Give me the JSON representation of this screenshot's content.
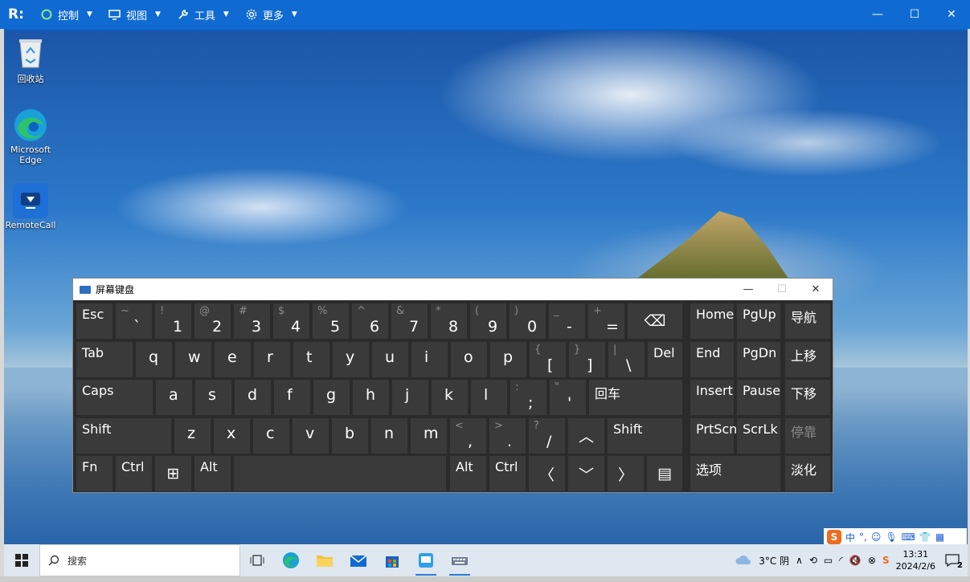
{
  "remote_bar": {
    "logo": "R:",
    "menus": [
      {
        "label": "控制",
        "icon": "power-icon"
      },
      {
        "label": "视图",
        "icon": "monitor-icon"
      },
      {
        "label": "工具",
        "icon": "wrench-icon"
      },
      {
        "label": "更多",
        "icon": "gear-icon"
      }
    ],
    "window_controls": {
      "minimize": "—",
      "maximize": "☐",
      "close": "✕"
    }
  },
  "desktop_icons": [
    {
      "label": "回收站",
      "icon": "recycle-bin-icon"
    },
    {
      "label": "Microsoft Edge",
      "icon": "edge-icon"
    },
    {
      "label": "RemoteCall",
      "icon": "remotecall-icon"
    }
  ],
  "osk": {
    "title": "屏幕键盘",
    "controls": {
      "minimize": "—",
      "maximize": "☐",
      "close": "✕"
    },
    "row1": [
      {
        "main": "Esc"
      },
      {
        "shift": "~",
        "main": "`"
      },
      {
        "shift": "!",
        "main": "1"
      },
      {
        "shift": "@",
        "main": "2"
      },
      {
        "shift": "#",
        "main": "3"
      },
      {
        "shift": "$",
        "main": "4"
      },
      {
        "shift": "%",
        "main": "5"
      },
      {
        "shift": "^",
        "main": "6"
      },
      {
        "shift": "&",
        "main": "7"
      },
      {
        "shift": "*",
        "main": "8"
      },
      {
        "shift": "(",
        "main": "9"
      },
      {
        "shift": ")",
        "main": "0"
      },
      {
        "shift": "_",
        "main": "-"
      },
      {
        "shift": "+",
        "main": "="
      },
      {
        "main": "⌫"
      }
    ],
    "row2": [
      {
        "main": "Tab"
      },
      {
        "main": "q"
      },
      {
        "main": "w"
      },
      {
        "main": "e"
      },
      {
        "main": "r"
      },
      {
        "main": "t"
      },
      {
        "main": "y"
      },
      {
        "main": "u"
      },
      {
        "main": "i"
      },
      {
        "main": "o"
      },
      {
        "main": "p"
      },
      {
        "shift": "{",
        "main": "["
      },
      {
        "shift": "}",
        "main": "]"
      },
      {
        "shift": "|",
        "main": "\\"
      },
      {
        "main": "Del"
      }
    ],
    "row3": [
      {
        "main": "Caps"
      },
      {
        "main": "a"
      },
      {
        "main": "s"
      },
      {
        "main": "d"
      },
      {
        "main": "f"
      },
      {
        "main": "g"
      },
      {
        "main": "h"
      },
      {
        "main": "j"
      },
      {
        "main": "k"
      },
      {
        "main": "l"
      },
      {
        "shift": ":",
        "main": ";"
      },
      {
        "shift": "\"",
        "main": "'"
      },
      {
        "main": "回车"
      }
    ],
    "row4": [
      {
        "main": "Shift"
      },
      {
        "main": "z"
      },
      {
        "main": "x"
      },
      {
        "main": "c"
      },
      {
        "main": "v"
      },
      {
        "main": "b"
      },
      {
        "main": "n"
      },
      {
        "main": "m"
      },
      {
        "shift": "<",
        "main": ","
      },
      {
        "shift": ">",
        "main": "."
      },
      {
        "shift": "?",
        "main": "/"
      },
      {
        "main": "︿"
      },
      {
        "main": "Shift"
      }
    ],
    "row5": [
      {
        "main": "Fn"
      },
      {
        "main": "Ctrl"
      },
      {
        "main": "⊞"
      },
      {
        "main": "Alt"
      },
      {
        "main": ""
      },
      {
        "main": "Alt"
      },
      {
        "main": "Ctrl"
      },
      {
        "main": "〈"
      },
      {
        "main": "﹀"
      },
      {
        "main": "〉"
      },
      {
        "main": "▤"
      }
    ],
    "nav": {
      "home": "Home",
      "pgup": "PgUp",
      "nav": "导航",
      "end": "End",
      "pgdn": "PgDn",
      "up": "上移",
      "insert": "Insert",
      "pause": "Pause",
      "down": "下移",
      "prtscn": "PrtScn",
      "scrlk": "ScrLk",
      "dock": "停靠",
      "options": "选项",
      "fade": "淡化"
    }
  },
  "taskbar": {
    "search_placeholder": "搜索",
    "weather": "3°C 阴",
    "time": "13:31",
    "date": "2024/2/6",
    "notification_count": "2",
    "ime_label": "中"
  },
  "colors": {
    "remote_bar": "#0f6bd2",
    "osk_bg": "#2b2b2b",
    "osk_key": "#3a3a3a",
    "taskbar": "#dfe7f0",
    "accent": "#2b7bd8"
  }
}
